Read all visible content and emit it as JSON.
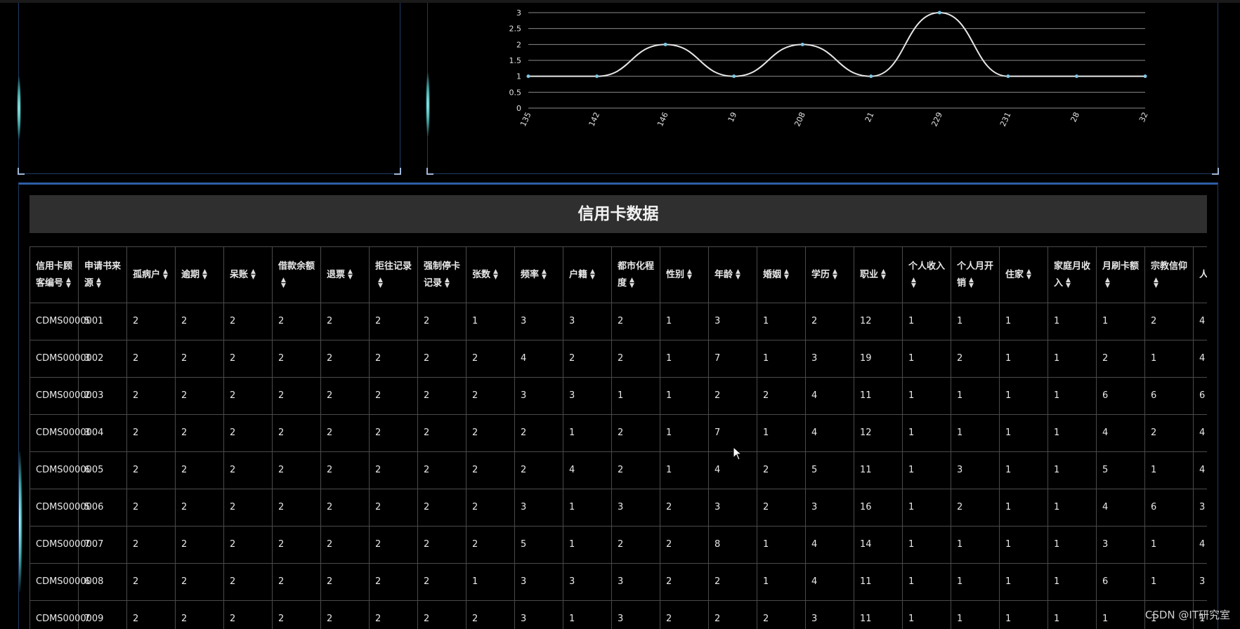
{
  "table": {
    "title": "信用卡数据",
    "headers": [
      "信用卡顾客编号",
      "申请书来源",
      "孤病户",
      "逾期",
      "呆账",
      "借款余额",
      "退票",
      "拒往记录",
      "强制停卡记录",
      "张数",
      "频率",
      "户籍",
      "都市化程度",
      "性别",
      "年龄",
      "婚姻",
      "学历",
      "职业",
      "个人收入",
      "个人月开销",
      "住家",
      "家庭月收入",
      "月刷卡额",
      "宗教信仰",
      "人"
    ],
    "rows": [
      [
        "CDMS0000001",
        "5",
        "2",
        "2",
        "2",
        "2",
        "2",
        "2",
        "2",
        "1",
        "3",
        "3",
        "2",
        "1",
        "3",
        "1",
        "2",
        "12",
        "1",
        "1",
        "1",
        "1",
        "1",
        "2",
        "4"
      ],
      [
        "CDMS0000002",
        "3",
        "2",
        "2",
        "2",
        "2",
        "2",
        "2",
        "2",
        "2",
        "4",
        "2",
        "2",
        "1",
        "7",
        "1",
        "3",
        "19",
        "1",
        "2",
        "1",
        "1",
        "2",
        "1",
        "4"
      ],
      [
        "CDMS0000003",
        "2",
        "2",
        "2",
        "2",
        "2",
        "2",
        "2",
        "2",
        "2",
        "3",
        "3",
        "1",
        "1",
        "2",
        "2",
        "4",
        "11",
        "1",
        "1",
        "1",
        "1",
        "6",
        "6",
        "6"
      ],
      [
        "CDMS0000004",
        "3",
        "2",
        "2",
        "2",
        "2",
        "2",
        "2",
        "2",
        "2",
        "2",
        "1",
        "2",
        "1",
        "7",
        "1",
        "4",
        "12",
        "1",
        "1",
        "1",
        "1",
        "4",
        "2",
        "4"
      ],
      [
        "CDMS0000005",
        "6",
        "2",
        "2",
        "2",
        "2",
        "2",
        "2",
        "2",
        "2",
        "2",
        "4",
        "2",
        "1",
        "4",
        "2",
        "5",
        "11",
        "1",
        "3",
        "1",
        "1",
        "5",
        "1",
        "4"
      ],
      [
        "CDMS0000006",
        "5",
        "2",
        "2",
        "2",
        "2",
        "2",
        "2",
        "2",
        "2",
        "3",
        "1",
        "3",
        "2",
        "3",
        "2",
        "3",
        "16",
        "1",
        "2",
        "1",
        "1",
        "4",
        "6",
        "3"
      ],
      [
        "CDMS0000007",
        "7",
        "2",
        "2",
        "2",
        "2",
        "2",
        "2",
        "2",
        "2",
        "5",
        "1",
        "2",
        "2",
        "8",
        "1",
        "4",
        "14",
        "1",
        "1",
        "1",
        "1",
        "3",
        "1",
        "4"
      ],
      [
        "CDMS0000008",
        "6",
        "2",
        "2",
        "2",
        "2",
        "2",
        "2",
        "2",
        "1",
        "3",
        "3",
        "3",
        "2",
        "2",
        "1",
        "4",
        "11",
        "1",
        "1",
        "1",
        "1",
        "6",
        "1",
        "3"
      ],
      [
        "CDMS0000009",
        "7",
        "2",
        "2",
        "2",
        "2",
        "2",
        "2",
        "2",
        "2",
        "3",
        "1",
        "3",
        "2",
        "2",
        "2",
        "3",
        "11",
        "1",
        "1",
        "1",
        "1",
        "1",
        "1",
        "1"
      ]
    ]
  },
  "chart_data": {
    "type": "line",
    "categories": [
      "135",
      "142",
      "146",
      "19",
      "208",
      "21",
      "229",
      "231",
      "28",
      "32"
    ],
    "values": [
      1,
      1,
      2,
      1,
      2,
      1,
      3,
      1,
      1,
      1
    ],
    "ylim": [
      0,
      3
    ],
    "yticks": [
      "0",
      "0.5",
      "1",
      "1.5",
      "2",
      "2.5",
      "3"
    ],
    "grid": true,
    "colors": {
      "line": "#e6e6e6",
      "point": "#7ec8e3",
      "grid": "#8a8a8a"
    }
  },
  "watermark": "CSDN @IT研究室"
}
